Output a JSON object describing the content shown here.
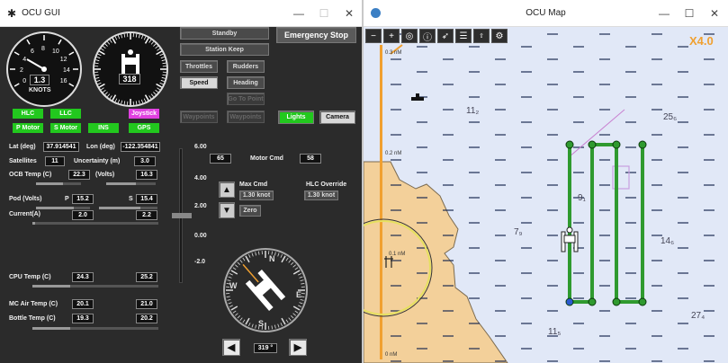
{
  "gui": {
    "title": "OCU GUI",
    "speed_gauge": {
      "value": "1.3",
      "unit": "KNOTS",
      "ticks": [
        "0",
        "2",
        "4",
        "6",
        "8",
        "10",
        "12",
        "14",
        "16"
      ]
    },
    "heading_gauge": {
      "value": "318"
    },
    "buttons": {
      "standby": "Standby",
      "station_keep": "Station Keep",
      "emergency_stop": "Emergency Stop",
      "throttles": "Throttles",
      "rudders": "Rudders",
      "speed": "Speed",
      "heading": "Heading",
      "go_to_point": "Go To Point",
      "waypoints_a": "Waypoints",
      "waypoints_b": "Waypoints",
      "lights": "Lights",
      "camera": "Camera",
      "zero": "Zero"
    },
    "indicators": {
      "hlc": "HLC",
      "llc": "LLC",
      "joystick": "Joystick",
      "p_motor": "P Motor",
      "s_motor": "S Motor",
      "ins": "INS",
      "gps": "GPS"
    },
    "telemetry": {
      "lat_label": "Lat (deg)",
      "lat": "37.914541",
      "lon_label": "Lon (deg)",
      "lon": "-122.354841",
      "sat_label": "Satellites",
      "sat": "11",
      "unc_label": "Uncertainty (m)",
      "unc": "3.0",
      "ocb_label": "OCB Temp (C)",
      "ocb": "22.3",
      "volts_label": "(Volts)",
      "volts": "16.3",
      "pod_label": "Pod (Volts)",
      "p_label": "P",
      "p_volts": "15.2",
      "s_label": "S",
      "s_volts": "15.4",
      "current_label": "Current(A)",
      "current_p": "2.0",
      "current_s": "2.2",
      "cpu_label": "CPU Temp (C)",
      "cpu_p": "24.3",
      "cpu_s": "25.2",
      "mcair_label": "MC Air Temp (C)",
      "mcair_p": "20.1",
      "mcair_s": "21.0",
      "bottle_label": "Bottle Temp (C)",
      "bottle_p": "19.3",
      "bottle_s": "20.2"
    },
    "throttle_scale": [
      "6.00",
      "4.00",
      "2.00",
      "0.00",
      "-2.0"
    ],
    "motor": {
      "left_value": "65",
      "label": "Motor Cmd",
      "value": "58"
    },
    "max_cmd": {
      "label": "Max Cmd",
      "value": "1.30 knot"
    },
    "hlc_override": {
      "label": "HLC Override",
      "value": "1.30 knot"
    },
    "compass": {
      "heading": "319 °",
      "letters": [
        "N",
        "E",
        "S",
        "W"
      ]
    }
  },
  "map": {
    "title": "OCU Map",
    "zoom": "X4.0",
    "toolbar": [
      "minus-icon",
      "plus-icon",
      "target-icon",
      "info-icon",
      "arrow-icon",
      "list-icon",
      "waypoint-icon",
      "gear-icon"
    ],
    "scale_marks": [
      "0.3 nM",
      "0.2 nM",
      "0.1 nM",
      "0 nM"
    ],
    "depth_labels": [
      "11₂",
      "25₆",
      "9₁",
      "7₉",
      "14₆",
      "11₅",
      "27₄"
    ],
    "colors": {
      "water": "#e1e8f7",
      "land": "#f3d09a",
      "track": "#2f9a2f",
      "scale": "#f0a030"
    }
  }
}
